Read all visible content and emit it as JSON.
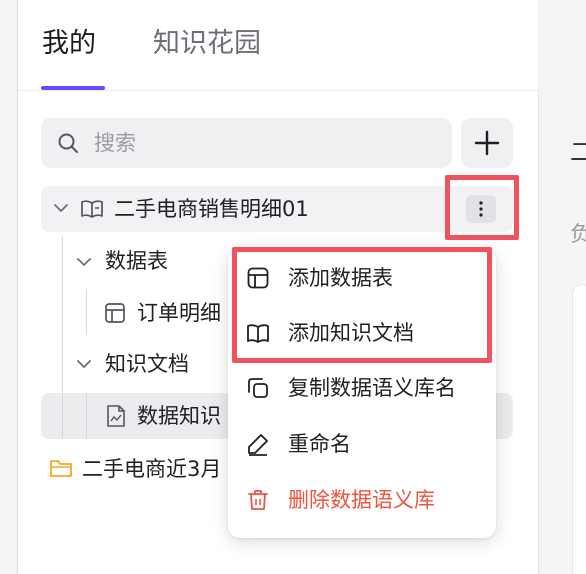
{
  "tabs": [
    {
      "label": "我的",
      "active": true
    },
    {
      "label": "知识花园",
      "active": false
    }
  ],
  "search": {
    "placeholder": "搜索"
  },
  "tree": {
    "root": {
      "label": "二手电商销售明细01",
      "expanded": true
    },
    "group_tables": {
      "label": "数据表"
    },
    "table_item": {
      "label": "订单明细"
    },
    "group_docs": {
      "label": "知识文档"
    },
    "doc_item": {
      "label": "数据知识"
    },
    "folder2": {
      "label": "二手电商近3月"
    }
  },
  "context_menu": {
    "items": [
      {
        "label": "添加数据表",
        "icon": "table-layout-icon"
      },
      {
        "label": "添加知识文档",
        "icon": "open-book-icon"
      },
      {
        "label": "复制数据语义库名",
        "icon": "copy-icon"
      },
      {
        "label": "重命名",
        "icon": "pencil-icon"
      },
      {
        "label": "删除数据语义库",
        "icon": "trash-icon",
        "danger": true
      }
    ]
  },
  "right_pane": {
    "glyph_top": "二",
    "glyph_sub": "负"
  },
  "colors": {
    "accent": "#6d4aff",
    "highlight": "#f0535d",
    "danger": "#f0533f",
    "folder": "#f5a623"
  }
}
